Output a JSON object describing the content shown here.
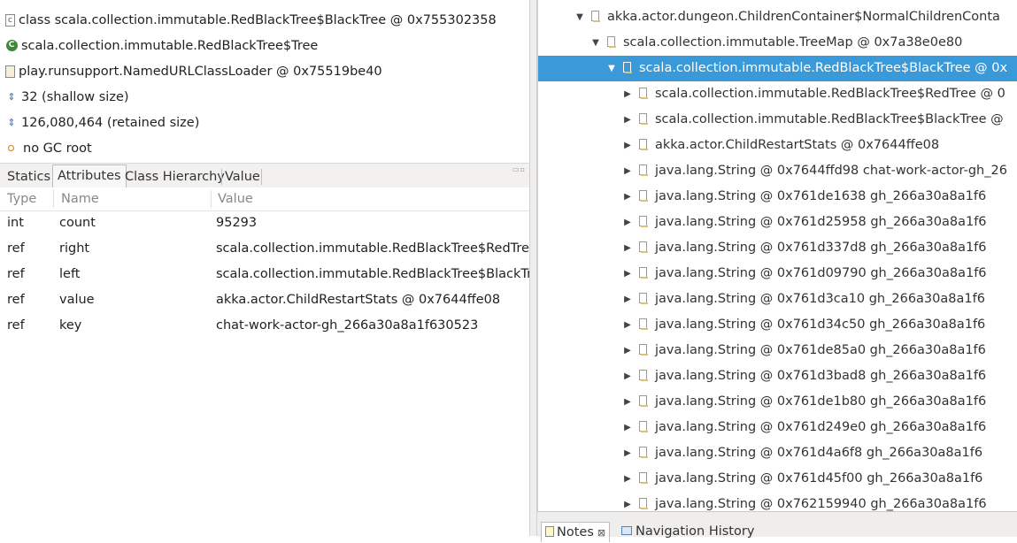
{
  "inspector": {
    "rows": [
      {
        "icon": "class-icon",
        "text": "class scala.collection.immutable.RedBlackTree$BlackTree @ 0x755302358"
      },
      {
        "icon": "superclass-icon",
        "text": "scala.collection.immutable.RedBlackTree$Tree"
      },
      {
        "icon": "classloader-icon",
        "text": "play.runsupport.NamedURLClassLoader @ 0x75519be40"
      },
      {
        "icon": "size-icon",
        "text": "32 (shallow size)"
      },
      {
        "icon": "size-icon",
        "text": "126,080,464 (retained size)"
      },
      {
        "icon": "gc-root-icon",
        "text": "no GC root"
      }
    ],
    "tabs": [
      "Statics",
      "Attributes",
      "Class Hierarchy",
      "Value"
    ],
    "active_tab": "Attributes",
    "columns": [
      "Type",
      "Name",
      "Value"
    ],
    "attributes": [
      {
        "type": "int",
        "name": "count",
        "value": "95293"
      },
      {
        "type": "ref",
        "name": "right",
        "value": "scala.collection.immutable.RedBlackTree$RedTree @"
      },
      {
        "type": "ref",
        "name": "left",
        "value": "scala.collection.immutable.RedBlackTree$BlackTree"
      },
      {
        "type": "ref",
        "name": "value",
        "value": "akka.actor.ChildRestartStats @ 0x7644ffe08"
      },
      {
        "type": "ref",
        "name": "key",
        "value": "chat-work-actor-gh_266a30a8a1f630523"
      }
    ]
  },
  "tree": {
    "nodes": [
      {
        "label": "akka.actor.dungeon.ChildrenContainer$NormalChildrenConta",
        "level": 0,
        "expanded": true,
        "selected": false
      },
      {
        "label": "scala.collection.immutable.TreeMap @ 0x7a38e0e80",
        "level": 1,
        "expanded": true,
        "selected": false
      },
      {
        "label": "scala.collection.immutable.RedBlackTree$BlackTree @ 0x",
        "level": 2,
        "expanded": true,
        "selected": true
      },
      {
        "label": "scala.collection.immutable.RedBlackTree$RedTree @ 0",
        "level": 3,
        "expanded": false,
        "selected": false
      },
      {
        "label": "scala.collection.immutable.RedBlackTree$BlackTree @",
        "level": 3,
        "expanded": false,
        "selected": false
      },
      {
        "label": "akka.actor.ChildRestartStats @ 0x7644ffe08",
        "level": 3,
        "expanded": false,
        "selected": false
      },
      {
        "label": "java.lang.String @ 0x7644ffd98  chat-work-actor-gh_26",
        "level": 3,
        "expanded": false,
        "selected": false
      },
      {
        "label": "java.lang.String @ 0x761de1638  gh_266a30a8a1f6",
        "level": 3,
        "expanded": false,
        "selected": false
      },
      {
        "label": "java.lang.String @ 0x761d25958  gh_266a30a8a1f6",
        "level": 3,
        "expanded": false,
        "selected": false
      },
      {
        "label": "java.lang.String @ 0x761d337d8  gh_266a30a8a1f6",
        "level": 3,
        "expanded": false,
        "selected": false
      },
      {
        "label": "java.lang.String @ 0x761d09790  gh_266a30a8a1f6",
        "level": 3,
        "expanded": false,
        "selected": false
      },
      {
        "label": "java.lang.String @ 0x761d3ca10  gh_266a30a8a1f6",
        "level": 3,
        "expanded": false,
        "selected": false
      },
      {
        "label": "java.lang.String @ 0x761d34c50  gh_266a30a8a1f6",
        "level": 3,
        "expanded": false,
        "selected": false
      },
      {
        "label": "java.lang.String @ 0x761de85a0  gh_266a30a8a1f6",
        "level": 3,
        "expanded": false,
        "selected": false
      },
      {
        "label": "java.lang.String @ 0x761d3bad8  gh_266a30a8a1f6",
        "level": 3,
        "expanded": false,
        "selected": false
      },
      {
        "label": "java.lang.String @ 0x761de1b80  gh_266a30a8a1f6",
        "level": 3,
        "expanded": false,
        "selected": false
      },
      {
        "label": "java.lang.String @ 0x761d249e0  gh_266a30a8a1f6",
        "level": 3,
        "expanded": false,
        "selected": false
      },
      {
        "label": "java.lang.String @ 0x761d4a6f8  gh_266a30a8a1f6",
        "level": 3,
        "expanded": false,
        "selected": false
      },
      {
        "label": "java.lang.String @ 0x761d45f00  gh_266a30a8a1f6",
        "level": 3,
        "expanded": false,
        "selected": false
      },
      {
        "label": "java.lang.String @ 0x762159940  gh_266a30a8a1f6",
        "level": 3,
        "expanded": false,
        "selected": false
      }
    ]
  },
  "bottom_tabs": {
    "notes": "Notes",
    "navigation_history": "Navigation History"
  },
  "colors": {
    "selection": "#3a9ad9",
    "panel_bg": "#efeeed"
  }
}
